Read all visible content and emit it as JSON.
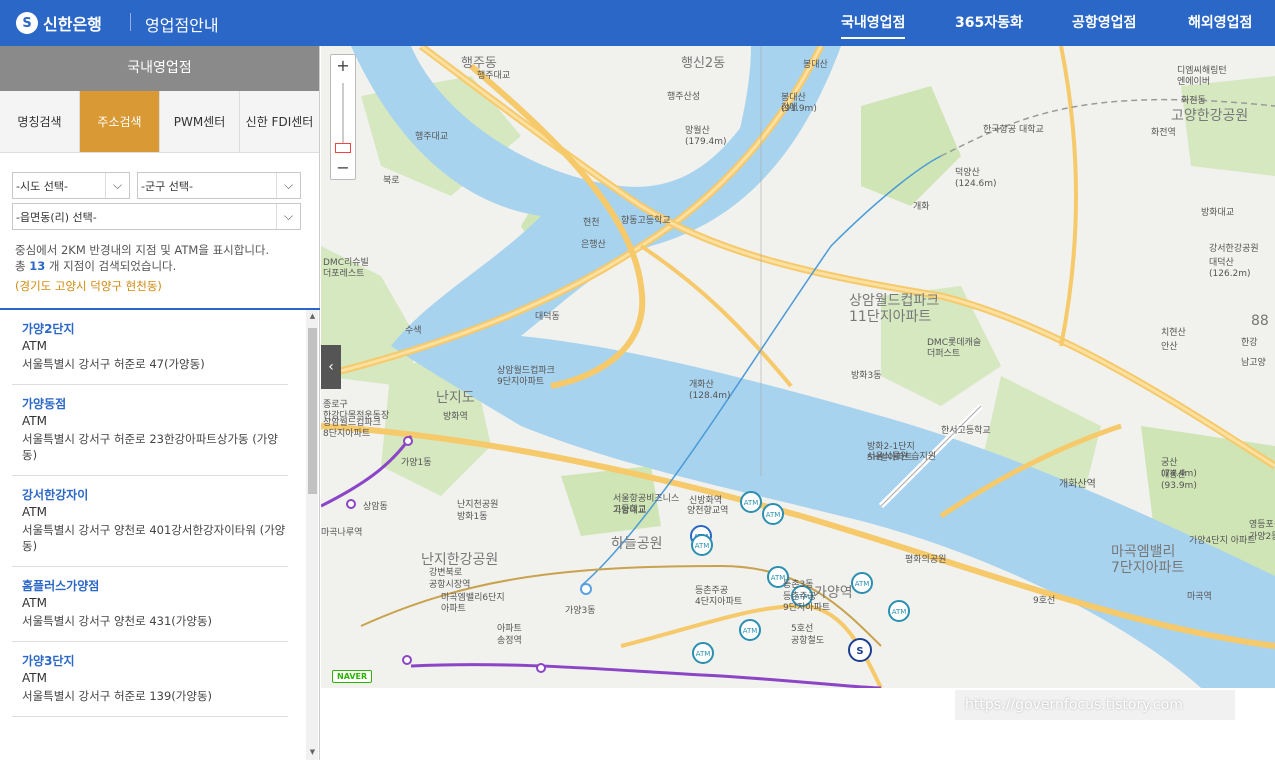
{
  "header": {
    "logo": "신한은행",
    "logo_mark": "S",
    "subtitle": "영업점안내",
    "nav": [
      "국내영업점",
      "365자동화",
      "공항영업점",
      "해외영업점"
    ],
    "nav_active": "국내영업점"
  },
  "sidebar": {
    "title": "국내영업점",
    "tabs": [
      "명칭검색",
      "주소검색",
      "PWM센터",
      "신한 FDI센터"
    ],
    "active_tab": "주소검색",
    "select_sido": "-시도 선택-",
    "select_gungu": "-군구 선택-",
    "select_dong": "-읍면동(리) 선택-",
    "info_line1": "중심에서 2KM 반경내의 지점 및 ATM을 표시합니다.",
    "info_prefix": "총",
    "info_count": "13",
    "info_suffix": "개 지점이 검색되었습니다.",
    "info_location": "(경기도 고양시 덕양구 현천동)",
    "results": [
      {
        "name": "가양2단지",
        "type": "ATM",
        "address": "서울특별시 강서구 허준로 47(가양동)"
      },
      {
        "name": "가양동점",
        "type": "ATM",
        "address": "서울특별시 강서구 허준로 23한강아파트상가동 (가양동)"
      },
      {
        "name": "강서한강자이",
        "type": "ATM",
        "address": "서울특별시 강서구 양천로 401강서한강자이타워 (가양동)"
      },
      {
        "name": "홈플러스가양점",
        "type": "ATM",
        "address": "서울특별시 강서구 양천로 431(가양동)"
      },
      {
        "name": "가양3단지",
        "type": "ATM",
        "address": "서울특별시 강서구 허준로 139(가양동)"
      }
    ]
  },
  "map": {
    "zoom_in": "+",
    "zoom_out": "−",
    "collapse": "‹",
    "provider": "NAVER",
    "atm_label": "ATM",
    "branch_mark": "S",
    "watermark": "https://governfocus.tistory.com",
    "colors": {
      "water": "#a8d3ee",
      "road": "#f6c96a",
      "park": "#cfe5b5",
      "subway_purple": "#8b45c6",
      "subway_blue": "#4a9ad8",
      "atm": "#2a8fb0"
    },
    "labels": [
      "행주동",
      "행신2동",
      "행주대교",
      "봉대산",
      "봉대산 (91.9m)",
      "강매",
      "행주산성",
      "망월산 (179.4m)",
      "디엠씨해링턴 엔에이버",
      "화전동",
      "화전역",
      "고양한강공원",
      "한국항공 대학교",
      "행주대교",
      "덕양산 (124.6m)",
      "북로",
      "현천",
      "은행산",
      "향동고등학교",
      "개화",
      "방화대교",
      "DMC리슈빌 더포레스트",
      "대덕동",
      "강서한강공원",
      "대덕산 (126.2m)",
      "상암월드컵파크 11단지아파트",
      "수색",
      "DMC롯데캐슬 더퍼스트",
      "88",
      "한강",
      "남고양",
      "상암월드컵파크 9단지아파트",
      "개화산 (128.4m)",
      "방화3동",
      "치현산",
      "안산",
      "종로구 한강다목적운동장",
      "상암월드컵파크 8단지아파트",
      "난지도",
      "방화역",
      "한서고등학교",
      "방화2-1단지 SH빌아파트",
      "서울식물원 습지원",
      "궁산 (74.4m)",
      "매봉산 (93.9m)",
      "개화산역",
      "가양1동",
      "상암동",
      "난지천공원",
      "방화1동",
      "서울항공비즈니스 고등학교",
      "가양대교",
      "신방화역",
      "양천향교역",
      "영등포공업 고등학교",
      "가양2동",
      "마곡나루역",
      "하늘공원",
      "마곡엠밸리 7단지아파트",
      "가양4단지 아파트",
      "난지한강공원",
      "강변북로",
      "공항시장역",
      "평화의공원",
      "마곡엠밸리6단지 아파트",
      "등촌주공 4단지아파트",
      "등촌3동",
      "등촌주공 9단지아파트",
      "가양역",
      "가양3동",
      "아파트",
      "송정역",
      "마곡역",
      "5호선",
      "공항철도",
      "9호선"
    ]
  }
}
